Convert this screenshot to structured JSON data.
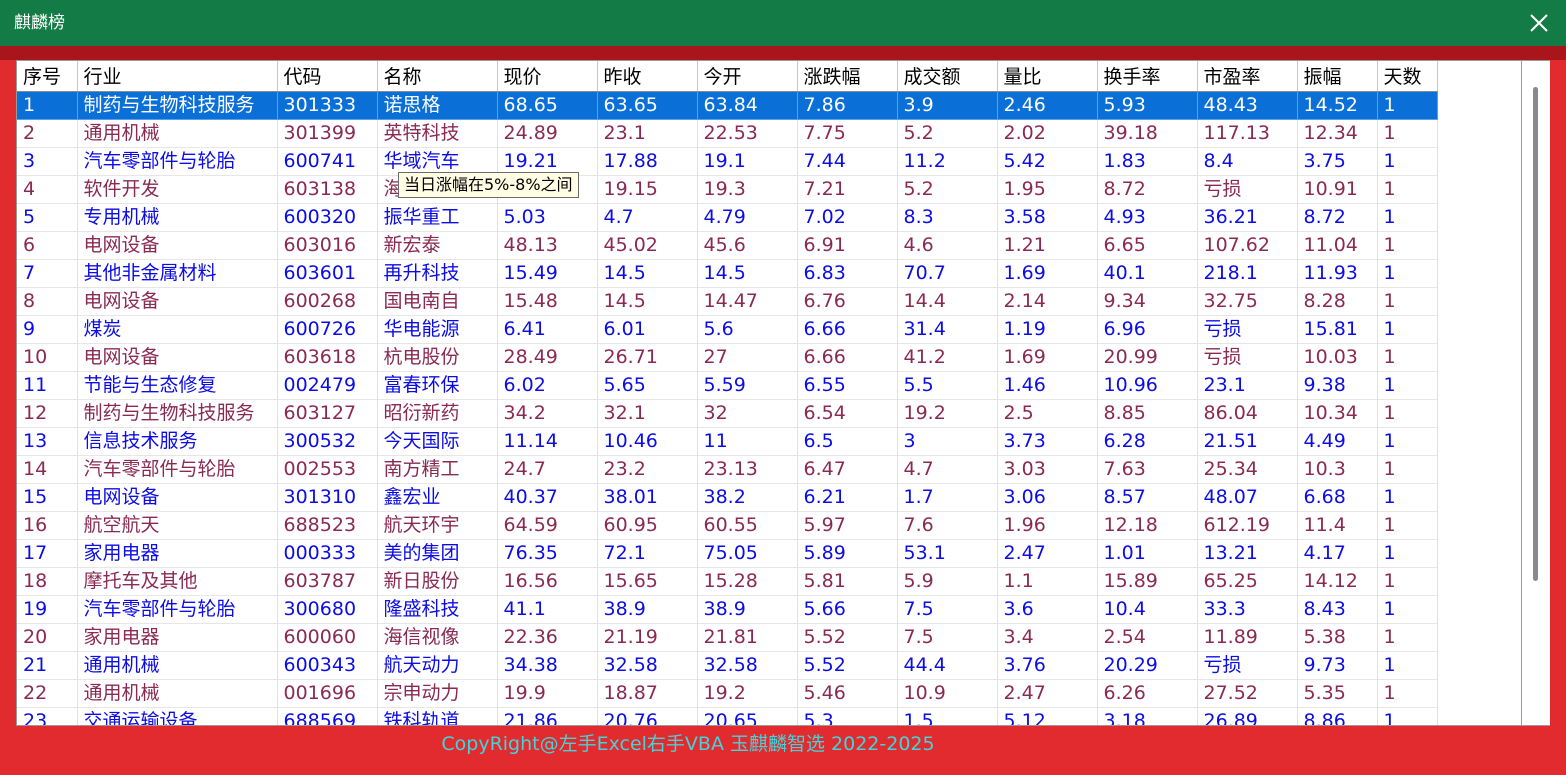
{
  "window": {
    "title": "麒麟榜",
    "close_icon": "close-icon"
  },
  "table": {
    "columns": [
      "序号",
      "行业",
      "代码",
      "名称",
      "现价",
      "昨收",
      "今开",
      "涨跌幅",
      "成交额",
      "量比",
      "换手率",
      "市盈率",
      "振幅",
      "天数"
    ],
    "rows": [
      [
        "1",
        "制药与生物科技服务",
        "301333",
        "诺思格",
        "68.65",
        "63.65",
        "63.84",
        "7.86",
        "3.9",
        "2.46",
        "5.93",
        "48.43",
        "14.52",
        "1"
      ],
      [
        "2",
        "通用机械",
        "301399",
        "英特科技",
        "24.89",
        "23.1",
        "22.53",
        "7.75",
        "5.2",
        "2.02",
        "39.18",
        "117.13",
        "12.34",
        "1"
      ],
      [
        "3",
        "汽车零部件与轮胎",
        "600741",
        "华域汽车",
        "19.21",
        "17.88",
        "19.1",
        "7.44",
        "11.2",
        "5.42",
        "1.83",
        "8.4",
        "3.75",
        "1"
      ],
      [
        "4",
        "软件开发",
        "603138",
        "海",
        "",
        "19.15",
        "19.3",
        "7.21",
        "5.2",
        "1.95",
        "8.72",
        "亏损",
        "10.91",
        "1"
      ],
      [
        "5",
        "专用机械",
        "600320",
        "振华重工",
        "5.03",
        "4.7",
        "4.79",
        "7.02",
        "8.3",
        "3.58",
        "4.93",
        "36.21",
        "8.72",
        "1"
      ],
      [
        "6",
        "电网设备",
        "603016",
        "新宏泰",
        "48.13",
        "45.02",
        "45.6",
        "6.91",
        "4.6",
        "1.21",
        "6.65",
        "107.62",
        "11.04",
        "1"
      ],
      [
        "7",
        "其他非金属材料",
        "603601",
        "再升科技",
        "15.49",
        "14.5",
        "14.5",
        "6.83",
        "70.7",
        "1.69",
        "40.1",
        "218.1",
        "11.93",
        "1"
      ],
      [
        "8",
        "电网设备",
        "600268",
        "国电南自",
        "15.48",
        "14.5",
        "14.47",
        "6.76",
        "14.4",
        "2.14",
        "9.34",
        "32.75",
        "8.28",
        "1"
      ],
      [
        "9",
        "煤炭",
        "600726",
        "华电能源",
        "6.41",
        "6.01",
        "5.6",
        "6.66",
        "31.4",
        "1.19",
        "6.96",
        "亏损",
        "15.81",
        "1"
      ],
      [
        "10",
        "电网设备",
        "603618",
        "杭电股份",
        "28.49",
        "26.71",
        "27",
        "6.66",
        "41.2",
        "1.69",
        "20.99",
        "亏损",
        "10.03",
        "1"
      ],
      [
        "11",
        "节能与生态修复",
        "002479",
        "富春环保",
        "6.02",
        "5.65",
        "5.59",
        "6.55",
        "5.5",
        "1.46",
        "10.96",
        "23.1",
        "9.38",
        "1"
      ],
      [
        "12",
        "制药与生物科技服务",
        "603127",
        "昭衍新药",
        "34.2",
        "32.1",
        "32",
        "6.54",
        "19.2",
        "2.5",
        "8.85",
        "86.04",
        "10.34",
        "1"
      ],
      [
        "13",
        "信息技术服务",
        "300532",
        "今天国际",
        "11.14",
        "10.46",
        "11",
        "6.5",
        "3",
        "3.73",
        "6.28",
        "21.51",
        "4.49",
        "1"
      ],
      [
        "14",
        "汽车零部件与轮胎",
        "002553",
        "南方精工",
        "24.7",
        "23.2",
        "23.13",
        "6.47",
        "4.7",
        "3.03",
        "7.63",
        "25.34",
        "10.3",
        "1"
      ],
      [
        "15",
        "电网设备",
        "301310",
        "鑫宏业",
        "40.37",
        "38.01",
        "38.2",
        "6.21",
        "1.7",
        "3.06",
        "8.57",
        "48.07",
        "6.68",
        "1"
      ],
      [
        "16",
        "航空航天",
        "688523",
        "航天环宇",
        "64.59",
        "60.95",
        "60.55",
        "5.97",
        "7.6",
        "1.96",
        "12.18",
        "612.19",
        "11.4",
        "1"
      ],
      [
        "17",
        "家用电器",
        "000333",
        "美的集团",
        "76.35",
        "72.1",
        "75.05",
        "5.89",
        "53.1",
        "2.47",
        "1.01",
        "13.21",
        "4.17",
        "1"
      ],
      [
        "18",
        "摩托车及其他",
        "603787",
        "新日股份",
        "16.56",
        "15.65",
        "15.28",
        "5.81",
        "5.9",
        "1.1",
        "15.89",
        "65.25",
        "14.12",
        "1"
      ],
      [
        "19",
        "汽车零部件与轮胎",
        "300680",
        "隆盛科技",
        "41.1",
        "38.9",
        "38.9",
        "5.66",
        "7.5",
        "3.6",
        "10.4",
        "33.3",
        "8.43",
        "1"
      ],
      [
        "20",
        "家用电器",
        "600060",
        "海信视像",
        "22.36",
        "21.19",
        "21.81",
        "5.52",
        "7.5",
        "3.4",
        "2.54",
        "11.89",
        "5.38",
        "1"
      ],
      [
        "21",
        "通用机械",
        "600343",
        "航天动力",
        "34.38",
        "32.58",
        "32.58",
        "5.52",
        "44.4",
        "3.76",
        "20.29",
        "亏损",
        "9.73",
        "1"
      ],
      [
        "22",
        "通用机械",
        "001696",
        "宗申动力",
        "19.9",
        "18.87",
        "19.2",
        "5.46",
        "10.9",
        "2.47",
        "6.26",
        "27.52",
        "5.35",
        "1"
      ],
      [
        "23",
        "交通运输设备",
        "688569",
        "铁科轨道",
        "21.86",
        "20.76",
        "20.65",
        "5.3",
        "1.5",
        "5.12",
        "3.18",
        "26.89",
        "8.86",
        "1"
      ]
    ],
    "selected_row": 0
  },
  "tooltip": {
    "text": "当日涨幅在5%-8%之间"
  },
  "footer": {
    "text": "CopyRight@左手Excel右手VBA 玉麒麟智选  2022-2025"
  },
  "colors": {
    "titlebar": "#137b45",
    "frame": "#e12b2f",
    "odd_row_text": "#0c0ce6",
    "even_row_text": "#8a2a52",
    "selected_bg": "#0a6fd6",
    "footer_text": "#43d3d9"
  }
}
